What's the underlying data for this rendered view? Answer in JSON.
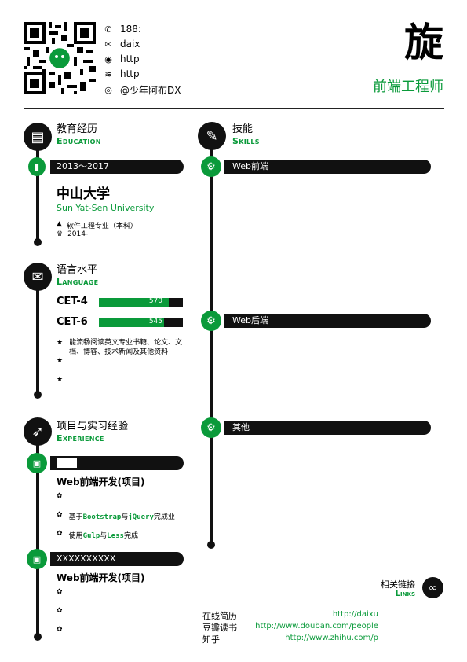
{
  "header": {
    "name_char": "旋",
    "title": "前端工程师",
    "contacts": [
      {
        "icon": "phone-icon",
        "glyph": "✆",
        "text": "188:"
      },
      {
        "icon": "mail-icon",
        "glyph": "✉",
        "text": "daix"
      },
      {
        "icon": "github-icon",
        "glyph": "◉",
        "text": "http"
      },
      {
        "icon": "rss-icon",
        "glyph": "≋",
        "text": "http"
      },
      {
        "icon": "weibo-icon",
        "glyph": "◎",
        "text": "@少年阿布DX"
      }
    ]
  },
  "education": {
    "cn": "教育经历",
    "en": "Education",
    "period": "2013～2017",
    "school": "中山大学",
    "school_en": "Sun Yat-Sen University",
    "major": "软件工程专业（本科）",
    "award": "2014-"
  },
  "language": {
    "cn": "语言水平",
    "en": "Language",
    "tests": [
      {
        "name": "CET-4",
        "score": "570",
        "fraction": 0.83
      },
      {
        "name": "CET-6",
        "score": "545",
        "fraction": 0.78
      }
    ],
    "bullets": [
      "能流畅阅读英文专业书籍、论文、文档、博客、技术新闻及其他资料",
      "",
      ""
    ]
  },
  "experience": {
    "cn": "项目与实习经验",
    "en": "Experience",
    "items": [
      {
        "bar_text": "",
        "title": "Web前端开发(项目)",
        "lines": [
          "",
          "基于Bootstrap与jQuery完成业",
          "使用Gulp与Less完成"
        ]
      },
      {
        "bar_text": "XXXXXXXXXX",
        "title": "Web前端开发(项目)",
        "lines": [
          "",
          "",
          ""
        ]
      }
    ]
  },
  "skills": {
    "cn": "技能",
    "en": "Skills",
    "bars": [
      "Web前端",
      "Web后端",
      "其他"
    ]
  },
  "links": {
    "cn": "相关链接",
    "en": "Links",
    "items": [
      {
        "label": "在线简历",
        "url": "http://daixu"
      },
      {
        "label": "豆瓣读书",
        "url": "http://www.douban.com/people"
      },
      {
        "label": "知乎",
        "url": "http://www.zhihu.com/p"
      }
    ]
  }
}
